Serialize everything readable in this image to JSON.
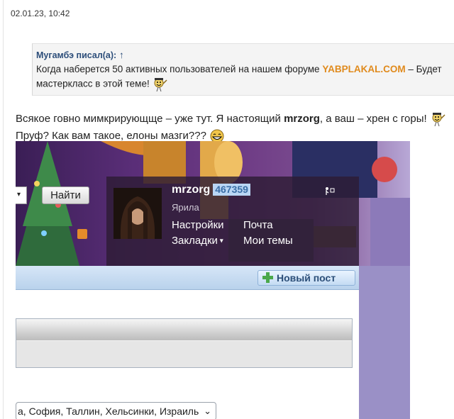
{
  "post": {
    "timestamp": "02.01.23, 10:42",
    "quote": {
      "author": "Мугамбэ писал(а):",
      "arrow": "↑",
      "line1_before": "Когда наберется 50 активных пользователей на нашем форуме ",
      "brand": "YABPLAKAL.COM",
      "line1_after": " – Будет",
      "line2": "мастеркласс в этой теме!"
    },
    "text_line1_before": "Всякое говно мимкрирующще – уже тут. Я настоящий ",
    "text_line1_bold": "mrzorg",
    "text_line1_after": ", а ваш – хрен с горы!",
    "text_line2": "Пруф? Как вам такое, елоны мазги???"
  },
  "screenshot": {
    "search_button": "Найти",
    "username": "mrzorg",
    "user_id": "467359",
    "user_role": "Ярила",
    "links": {
      "settings": "Настройки",
      "mail": "Почта",
      "bookmarks": "Закладки",
      "my_topics": "Мои темы"
    },
    "new_post_button": "Новый пост",
    "select_value": "а, София, Таллин, Хельсинки, Израиль"
  },
  "icons": {
    "smiley": "dancing-smiley-icon",
    "laughing": "laughing-smiley-icon",
    "plus": "plus-icon",
    "rss": "rss-icon",
    "chevron": "chevron-down-icon"
  },
  "colors": {
    "author": "#2d4e7a",
    "brand": "#e08a1c",
    "userid_bg": "#b9d6f4",
    "navbar": "#c8dcf1"
  }
}
